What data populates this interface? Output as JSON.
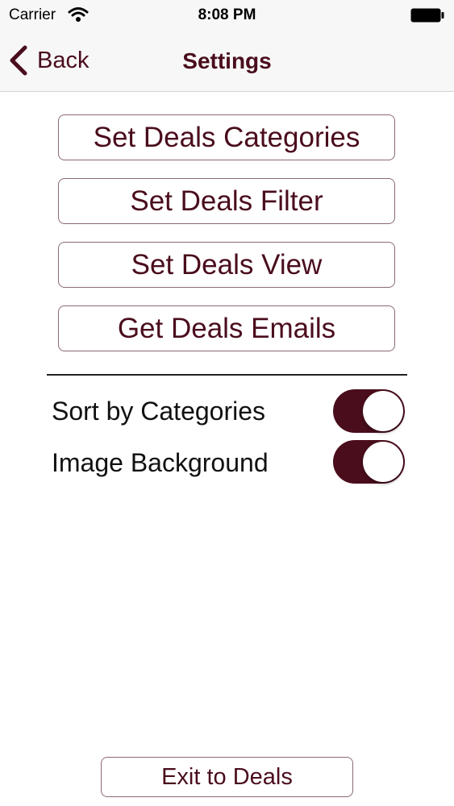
{
  "status_bar": {
    "carrier": "Carrier",
    "time": "8:08 PM"
  },
  "nav": {
    "back_label": "Back",
    "title": "Settings"
  },
  "options": [
    {
      "label": "Set Deals Categories"
    },
    {
      "label": "Set Deals Filter"
    },
    {
      "label": "Set Deals View"
    },
    {
      "label": "Get Deals Emails"
    }
  ],
  "toggles": [
    {
      "label": "Sort by Categories",
      "on": true
    },
    {
      "label": "Image Background",
      "on": true
    }
  ],
  "exit_button": {
    "label": "Exit to Deals"
  },
  "colors": {
    "accent": "#4a0d1c",
    "button_border": "#8a6a72",
    "bar_background": "#f7f7f7"
  },
  "icons": {
    "wifi": "wifi-icon",
    "battery": "battery-icon",
    "back": "chevron-left-icon"
  }
}
